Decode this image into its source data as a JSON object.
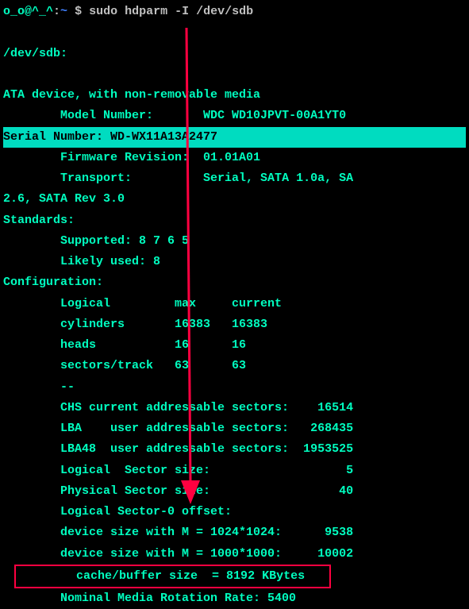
{
  "prompt": {
    "user_host": "o_o@^_^",
    "separator": ":",
    "path": "~",
    "marker": "$",
    "command": "sudo hdparm -I /dev/sdb"
  },
  "output": {
    "device_path": "/dev/sdb:",
    "device_type": "ATA device, with non-removable media",
    "model_label": "        Model Number:       ",
    "model_value": "WDC WD10JPVT-00A1YT0",
    "serial_label": "        Serial Number:      ",
    "serial_value": "WD-WX11A13A2477",
    "firmware_label": "        Firmware Revision:  ",
    "firmware_value": "01.01A01",
    "transport_label": "        Transport:          ",
    "transport_value": "Serial, SATA 1.0a, SA",
    "transport_cont": "2.6, SATA Rev 3.0",
    "standards_header": "Standards:",
    "supported_label": "        Supported: ",
    "supported_value": "8 7 6 5",
    "likely_label": "        Likely used: ",
    "likely_value": "8",
    "config_header": "Configuration:",
    "logical_header": "        Logical         max     current",
    "cylinders": "        cylinders       16383   16383",
    "heads": "        heads           16      16",
    "sectors_track": "        sectors/track   63      63",
    "dashes": "        --",
    "chs": "        CHS current addressable sectors:    16514",
    "lba": "        LBA    user addressable sectors:   268435",
    "lba48": "        LBA48  user addressable sectors:  1953525",
    "logical_sector": "        Logical  Sector size:                   5",
    "physical_sector": "        Physical Sector size:                  40",
    "logical_offset": "        Logical Sector-0 offset:                 ",
    "device_size_1024": "        device size with M = 1024*1024:      9538",
    "device_size_1000": "        device size with M = 1000*1000:     10002",
    "cache_buffer": "        cache/buffer size  = 8192 KBytes",
    "rotation": "        Nominal Media Rotation Rate: 5400"
  },
  "chart_data": {
    "type": "table",
    "title": "hdparm -I output for /dev/sdb",
    "device_info": {
      "Model Number": "WDC WD10JPVT-00A1YT0",
      "Serial Number": "WD-WX11A13A2477",
      "Firmware Revision": "01.01A01",
      "Transport": "Serial, SATA 1.0a, SA 2.6, SATA Rev 3.0"
    },
    "standards": {
      "Supported": "8 7 6 5",
      "Likely used": "8"
    },
    "configuration": {
      "cylinders": {
        "max": 16383,
        "current": 16383
      },
      "heads": {
        "max": 16,
        "current": 16
      },
      "sectors/track": {
        "max": 63,
        "current": 63
      },
      "CHS current addressable sectors": 16514,
      "LBA user addressable sectors": 268435,
      "LBA48 user addressable sectors": 1953525,
      "device size with M = 1024*1024": 9538,
      "device size with M = 1000*1000": 10002,
      "cache/buffer size": "8192 KBytes",
      "Nominal Media Rotation Rate": 5400
    },
    "highlighted_row": "Serial Number",
    "boxed_row": "cache/buffer size"
  }
}
